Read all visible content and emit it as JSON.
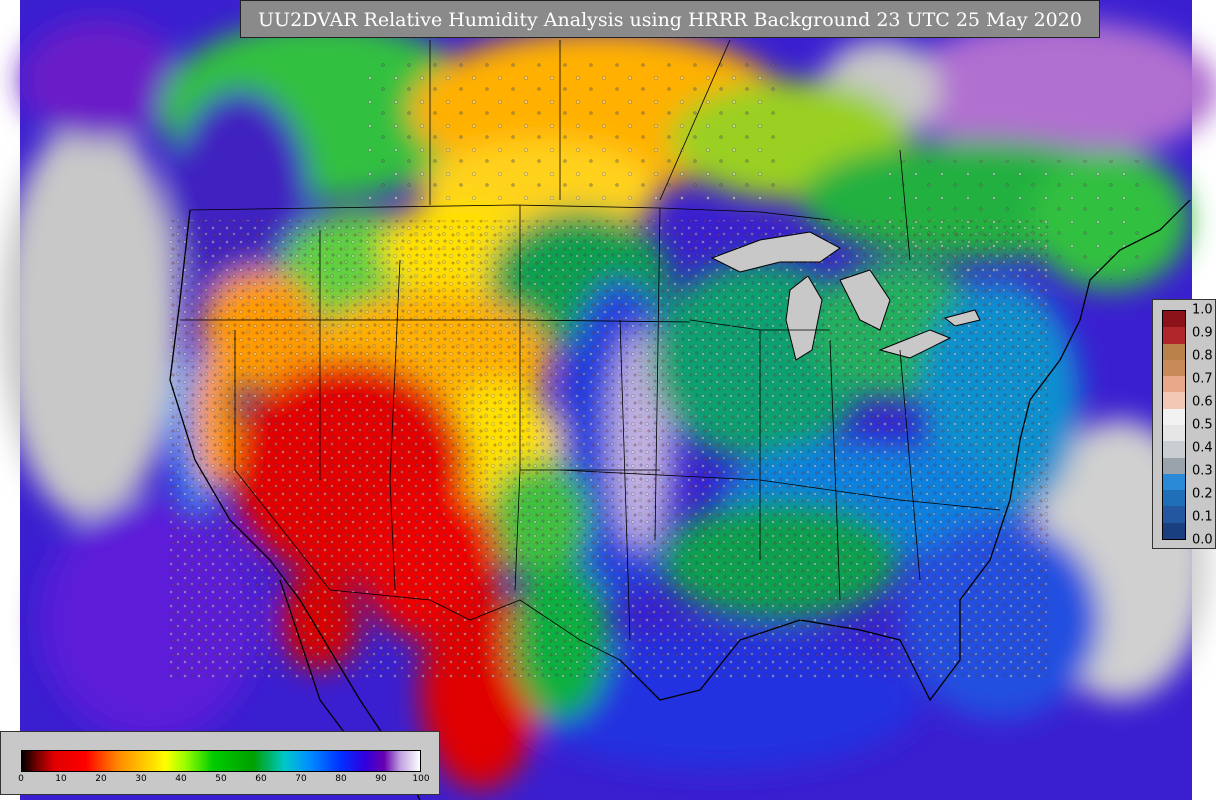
{
  "title": "UU2DVAR Relative Humidity Analysis using HRRR Background 23 UTC 25 May 2020",
  "obs_legend": {
    "ticks": [
      "1.0",
      "0.9",
      "0.8",
      "0.7",
      "0.6",
      "0.5",
      "0.4",
      "0.3",
      "0.2",
      "0.1",
      "0.0"
    ],
    "colors_top_to_bottom": [
      "#8b1218",
      "#b0262a",
      "#b8824a",
      "#c98a5a",
      "#e9a88a",
      "#f3c9b6",
      "#f2f2f2",
      "#e6e6e6",
      "#c9ced3",
      "#9aa2ab",
      "#2a8ad8",
      "#1f6fb8",
      "#2358a0",
      "#1a3f80"
    ]
  },
  "rh_colorbar": {
    "ticks": [
      "0",
      "10",
      "20",
      "30",
      "40",
      "50",
      "60",
      "70",
      "80",
      "90",
      "100"
    ],
    "min": 0,
    "max": 100,
    "stops": [
      [
        "#000000",
        0
      ],
      [
        "#7a0000",
        4
      ],
      [
        "#e00000",
        8
      ],
      [
        "#ff0000",
        16
      ],
      [
        "#ff8800",
        24
      ],
      [
        "#ffcc00",
        31
      ],
      [
        "#ffff00",
        36
      ],
      [
        "#9aff00",
        41
      ],
      [
        "#00cc00",
        48
      ],
      [
        "#00a000",
        58
      ],
      [
        "#00c8c8",
        66
      ],
      [
        "#0090ff",
        72
      ],
      [
        "#0030ff",
        80
      ],
      [
        "#3000e0",
        86
      ],
      [
        "#6600b0",
        91
      ],
      [
        "#c0a0e0",
        95
      ],
      [
        "#ffffff",
        100
      ]
    ]
  }
}
